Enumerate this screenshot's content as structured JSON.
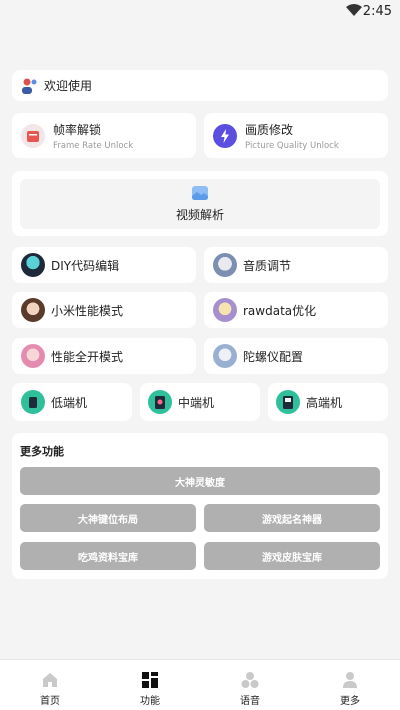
{
  "status": {
    "time": "2:45"
  },
  "welcome": {
    "label": "欢迎使用"
  },
  "top_cards": [
    {
      "title": "帧率解锁",
      "subtitle": "Frame Rate Unlock"
    },
    {
      "title": "画质修改",
      "subtitle": "Picture Quality Unlock"
    }
  ],
  "video": {
    "label": "视频解析"
  },
  "grid_items": [
    {
      "label": "DIY代码编辑"
    },
    {
      "label": "音质调节"
    },
    {
      "label": "小米性能模式"
    },
    {
      "label": "rawdata优化"
    },
    {
      "label": "性能全开模式"
    },
    {
      "label": "陀螺仪配置"
    }
  ],
  "tiers": [
    {
      "label": "低端机"
    },
    {
      "label": "中端机"
    },
    {
      "label": "高端机"
    }
  ],
  "more": {
    "title": "更多功能",
    "buttons": [
      "大神灵敏度",
      "大神键位布局",
      "游戏起名神器",
      "吃鸡资料宝库",
      "游戏皮肤宝库"
    ]
  },
  "nav": [
    {
      "label": "首页"
    },
    {
      "label": "功能"
    },
    {
      "label": "语音"
    },
    {
      "label": "更多"
    }
  ],
  "colors": {
    "background": "#f4f4f4",
    "card": "#ffffff",
    "gray_button": "#b0b0b0",
    "frame_icon": "#e8564f",
    "quality_icon": "#5b4fe0",
    "video_icon": "#6aa8f0"
  }
}
